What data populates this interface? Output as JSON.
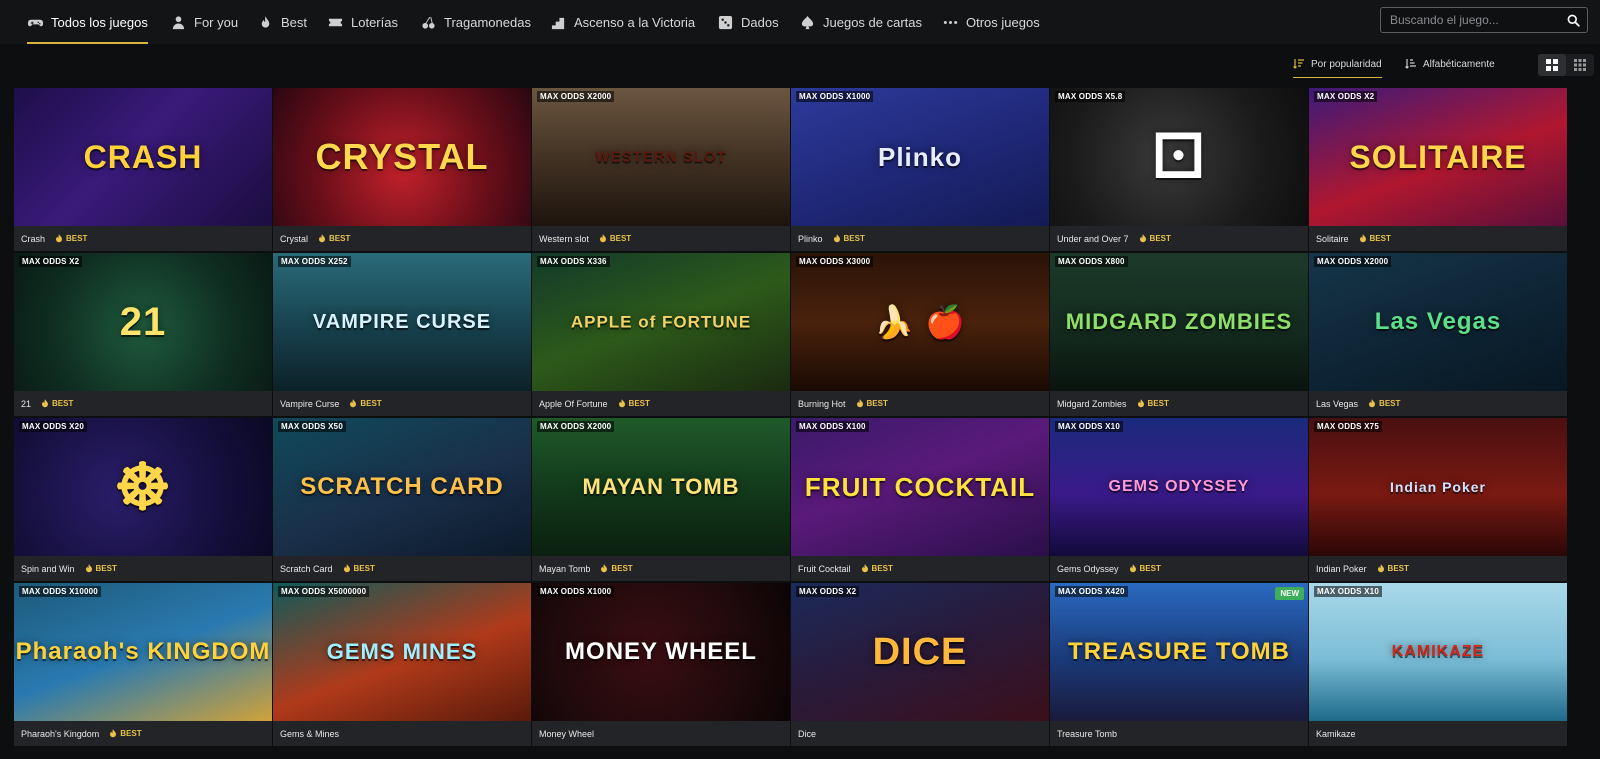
{
  "nav": {
    "items": [
      {
        "label": "Todos los juegos",
        "icon": "gamepad-icon",
        "active": true
      },
      {
        "label": "For you",
        "icon": "user-icon",
        "active": false
      },
      {
        "label": "Best",
        "icon": "flame-icon",
        "active": false
      },
      {
        "label": "Loterías",
        "icon": "ticket-icon",
        "active": false
      },
      {
        "label": "Tragamonedas",
        "icon": "cherry-icon",
        "active": false
      },
      {
        "label": "Ascenso a la Victoria",
        "icon": "steps-icon",
        "active": false
      },
      {
        "label": "Dados",
        "icon": "dice-icon",
        "active": false
      },
      {
        "label": "Juegos de cartas",
        "icon": "spade-icon",
        "active": false
      },
      {
        "label": "Otros juegos",
        "icon": "more-icon",
        "active": false
      }
    ],
    "search_placeholder": "Buscando el juego..."
  },
  "sort": {
    "popularity_label": "Por popularidad",
    "alpha_label": "Alfabéticamente"
  },
  "colors": {
    "accent": "#d6b640",
    "best": "#e8c24a",
    "background": "#0d0e10",
    "card_footer": "#232427"
  },
  "best_label": "BEST",
  "games": [
    {
      "name": "Crash",
      "odds": "",
      "best": true,
      "art": "CRASH"
    },
    {
      "name": "Crystal",
      "odds": "",
      "best": true,
      "art": "CRYSTAL"
    },
    {
      "name": "Western slot",
      "odds": "MAX ODDS X2000",
      "best": true,
      "art": "WESTERN SLOT"
    },
    {
      "name": "Plinko",
      "odds": "MAX ODDS X1000",
      "best": true,
      "art": "Plinko"
    },
    {
      "name": "Under and Over 7",
      "odds": "MAX ODDS X5.8",
      "best": true,
      "art": "⚀"
    },
    {
      "name": "Solitaire",
      "odds": "MAX ODDS X2",
      "best": true,
      "art": "SOLITAIRE"
    },
    {
      "name": "21",
      "odds": "MAX ODDS X2",
      "best": true,
      "art": "21"
    },
    {
      "name": "Vampire Curse",
      "odds": "MAX ODDS X252",
      "best": true,
      "art": "VAMPIRE CURSE"
    },
    {
      "name": "Apple Of Fortune",
      "odds": "MAX ODDS X336",
      "best": true,
      "art": "APPLE of FORTUNE"
    },
    {
      "name": "Burning Hot",
      "odds": "MAX ODDS X3000",
      "best": true,
      "art": "🍌 🍎"
    },
    {
      "name": "Midgard Zombies",
      "odds": "MAX ODDS X800",
      "best": true,
      "art": "MIDGARD ZOMBIES"
    },
    {
      "name": "Las Vegas",
      "odds": "MAX ODDS X2000",
      "best": true,
      "art": "Las Vegas"
    },
    {
      "name": "Spin and Win",
      "odds": "MAX ODDS X20",
      "best": true,
      "art": "☸"
    },
    {
      "name": "Scratch Card",
      "odds": "MAX ODDS X50",
      "best": true,
      "art": "SCRATCH CARD"
    },
    {
      "name": "Mayan Tomb",
      "odds": "MAX ODDS X2000",
      "best": true,
      "art": "MAYAN TOMB"
    },
    {
      "name": "Fruit Cocktail",
      "odds": "MAX ODDS X100",
      "best": true,
      "art": "FRUIT COCKTAIL"
    },
    {
      "name": "Gems Odyssey",
      "odds": "MAX ODDS X10",
      "best": true,
      "art": "GEMS ODYSSEY"
    },
    {
      "name": "Indian Poker",
      "odds": "MAX ODDS X75",
      "best": true,
      "art": "Indian Poker"
    },
    {
      "name": "Pharaoh's Kingdom",
      "odds": "MAX ODDS X10000",
      "best": true,
      "art": "Pharaoh's KINGDOM"
    },
    {
      "name": "Gems & Mines",
      "odds": "MAX ODDS X5000000",
      "best": false,
      "art": "GEMS MINES"
    },
    {
      "name": "Money Wheel",
      "odds": "MAX ODDS X1000",
      "best": false,
      "art": "MONEY WHEEL"
    },
    {
      "name": "Dice",
      "odds": "MAX ODDS X2",
      "best": false,
      "art": "DICE"
    },
    {
      "name": "Treasure Tomb",
      "odds": "MAX ODDS X420",
      "best": false,
      "art": "TREASURE TOMB",
      "badge": "NEW"
    },
    {
      "name": "Kamikaze",
      "odds": "MAX ODDS X10",
      "best": false,
      "art": "KAMIKAZE"
    }
  ]
}
